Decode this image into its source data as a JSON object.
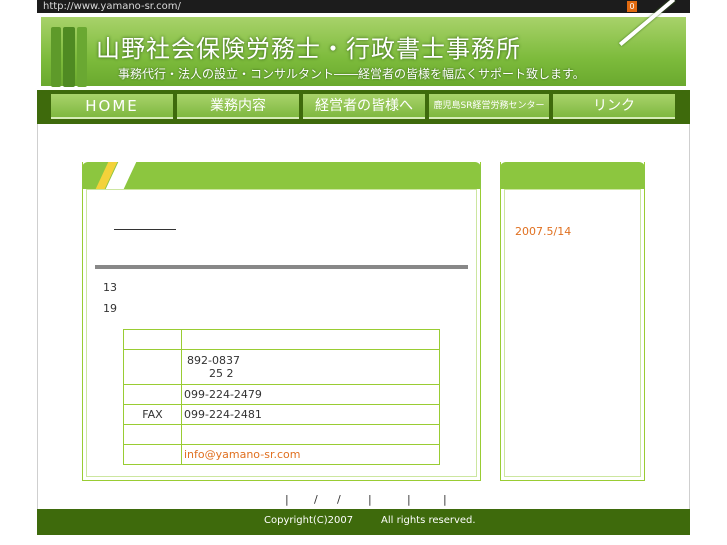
{
  "topbar": {
    "url": "http://www.yamano-sr.com/",
    "icon_label": "0"
  },
  "header": {
    "title": "山野社会保険労務士・行政書士事務所",
    "subtitle": "事務代行・法人の設立・コンサルタント――経営者の皆様を幅広くサポート致します。"
  },
  "nav": {
    "items": [
      {
        "label": "HOME"
      },
      {
        "label": "業務内容"
      },
      {
        "label": "経営者の皆様へ"
      },
      {
        "label": "鹿児島SR経営労務センター"
      },
      {
        "label": "リンク"
      }
    ]
  },
  "main": {
    "line1": "13",
    "line2": "19",
    "table": {
      "postal": "892-0837",
      "address_line2": "25 2",
      "tel": "099-224-2479",
      "fax_label": "FAX",
      "fax": "099-224-2481",
      "email": "info@yamano-sr.com"
    }
  },
  "side": {
    "news_date": "2007.5/14"
  },
  "footer": {
    "separators": [
      "|",
      "/",
      "/",
      "|",
      "|",
      "|"
    ],
    "copyright": "Copyright(C)2007",
    "rights": "All rights reserved."
  },
  "colors": {
    "accent_green": "#8cc63f",
    "dark_green": "#3e6a0c",
    "link_orange": "#e07020"
  }
}
